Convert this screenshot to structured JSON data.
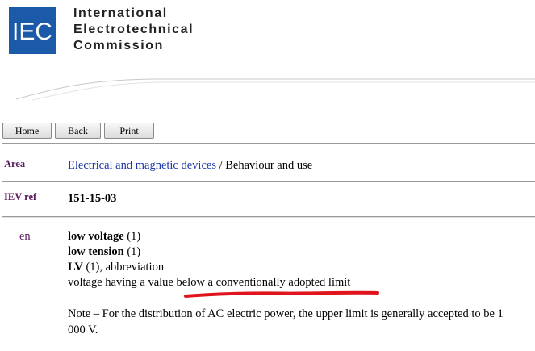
{
  "header": {
    "logo_text": "IEC",
    "org_lines": [
      "International",
      "Electrotechnical",
      "Commission"
    ]
  },
  "toolbar": {
    "home_label": "Home",
    "back_label": "Back",
    "print_label": "Print"
  },
  "area": {
    "label": "Area",
    "link": "Electrical and magnetic devices",
    "separator": " / ",
    "rest": "Behaviour and use"
  },
  "ievref": {
    "label": "IEV ref",
    "value": "151-15-03"
  },
  "entry": {
    "lang": "en",
    "term1": "low voltage",
    "term1_suffix": " (1)",
    "term2": "low tension",
    "term2_suffix": " (1)",
    "term3": "LV",
    "term3_suffix": " (1), abbreviation",
    "definition": "voltage having a value below a conventionally adopted limit",
    "note": "Note – For the distribution of AC electric power, the upper limit is generally accepted to be 1 000 V."
  },
  "colors": {
    "logo_blue": "#1a5aa8",
    "label_purple": "#5b1a5e",
    "link_blue": "#1d39a8",
    "annotation_red": "#e0141c"
  }
}
